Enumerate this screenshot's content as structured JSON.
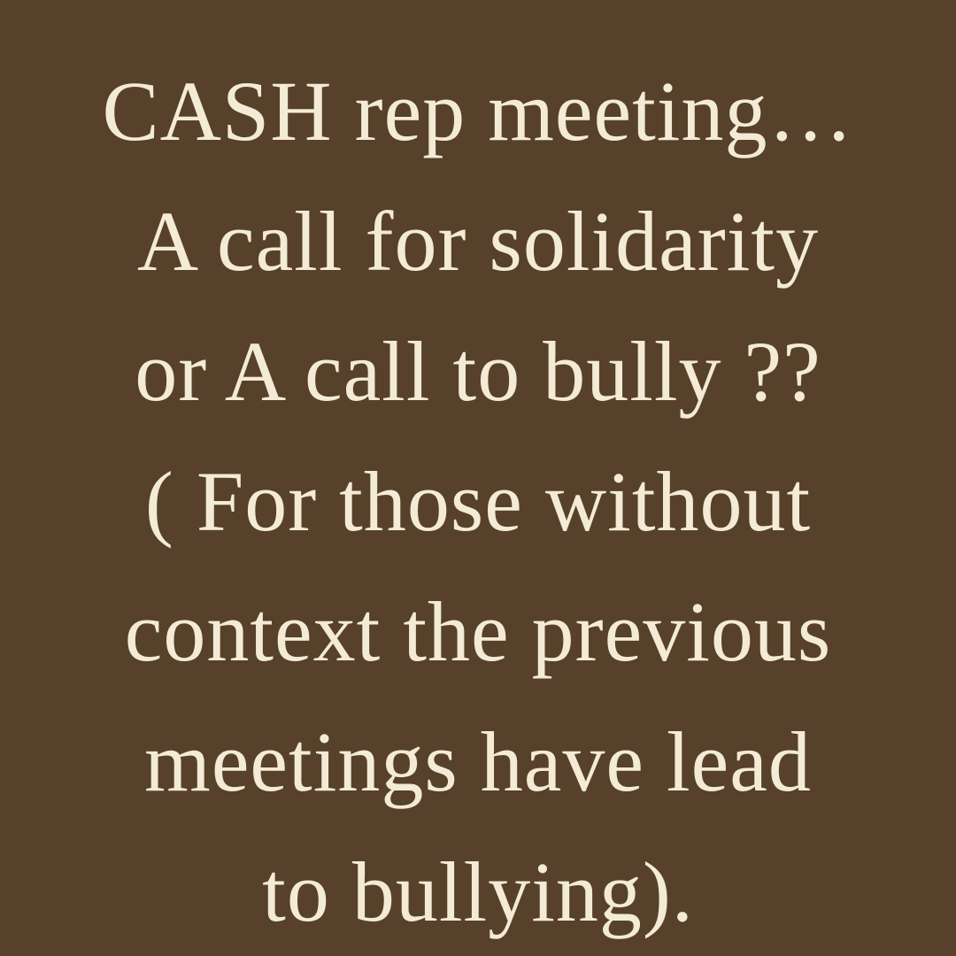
{
  "colors": {
    "background": "#57412b",
    "text": "#f3ebd5"
  },
  "post": {
    "lines": [
      "CASH rep meeting…",
      "A call for solidarity",
      "or A call to bully ??",
      "( For those without",
      "context the previous",
      "meetings have lead",
      "to bullying)."
    ]
  }
}
